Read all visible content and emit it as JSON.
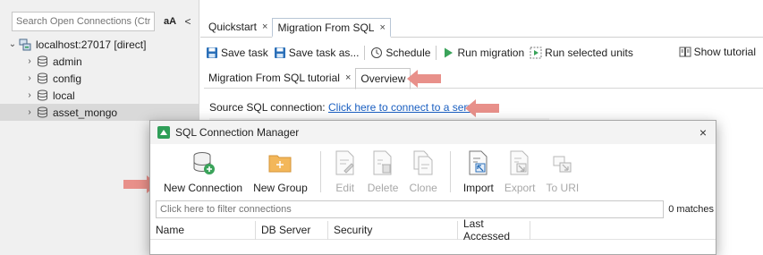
{
  "sidebar": {
    "search_placeholder": "Search Open Connections (Ctrl+I",
    "aa_label": "aA",
    "collapse_glyph": "<",
    "root": {
      "label": "localhost:27017 [direct]",
      "icon": "server-icon"
    },
    "databases": [
      {
        "label": "admin",
        "icon": "database-icon"
      },
      {
        "label": "config",
        "icon": "database-icon"
      },
      {
        "label": "local",
        "icon": "database-icon"
      },
      {
        "label": "asset_mongo",
        "icon": "database-icon",
        "selected": true
      }
    ]
  },
  "tabs": [
    {
      "label": "Quickstart",
      "close": "×",
      "active": false
    },
    {
      "label": "Migration From SQL",
      "close": "×",
      "active": true
    }
  ],
  "toolbar": {
    "save_task": "Save task",
    "save_task_as": "Save task as...",
    "schedule": "Schedule",
    "run_migration": "Run migration",
    "run_selected_units": "Run selected units",
    "show_tutorial": "Show tutorial"
  },
  "subtabs": [
    {
      "label": "Migration From SQL tutorial",
      "close": "×",
      "active": false
    },
    {
      "label": "Overview",
      "active": true
    }
  ],
  "source": {
    "label": "Source SQL connection:",
    "link": "Click here to connect to a server ..."
  },
  "dialog": {
    "title": "SQL Connection Manager",
    "close": "×",
    "ribbon": [
      {
        "label": "New Connection",
        "icon": "new-connection-icon",
        "enabled": true
      },
      {
        "label": "New Group",
        "icon": "folder-icon",
        "enabled": true
      },
      {
        "label": "Edit",
        "icon": "edit-icon",
        "enabled": false
      },
      {
        "label": "Delete",
        "icon": "delete-icon",
        "enabled": false
      },
      {
        "label": "Clone",
        "icon": "clone-icon",
        "enabled": false
      },
      {
        "label": "Import",
        "icon": "import-icon",
        "enabled": true
      },
      {
        "label": "Export",
        "icon": "export-icon",
        "enabled": false
      },
      {
        "label": "To URI",
        "icon": "to-uri-icon",
        "enabled": false
      }
    ],
    "filter_placeholder": "Click here to filter connections",
    "matches": "0 matches",
    "columns": [
      "Name",
      "DB Server",
      "Security",
      "Last Accessed"
    ]
  },
  "colors": {
    "annotation_arrow": "#e8908a",
    "link": "#1a5fc1",
    "accent_green": "#2f9e58"
  }
}
